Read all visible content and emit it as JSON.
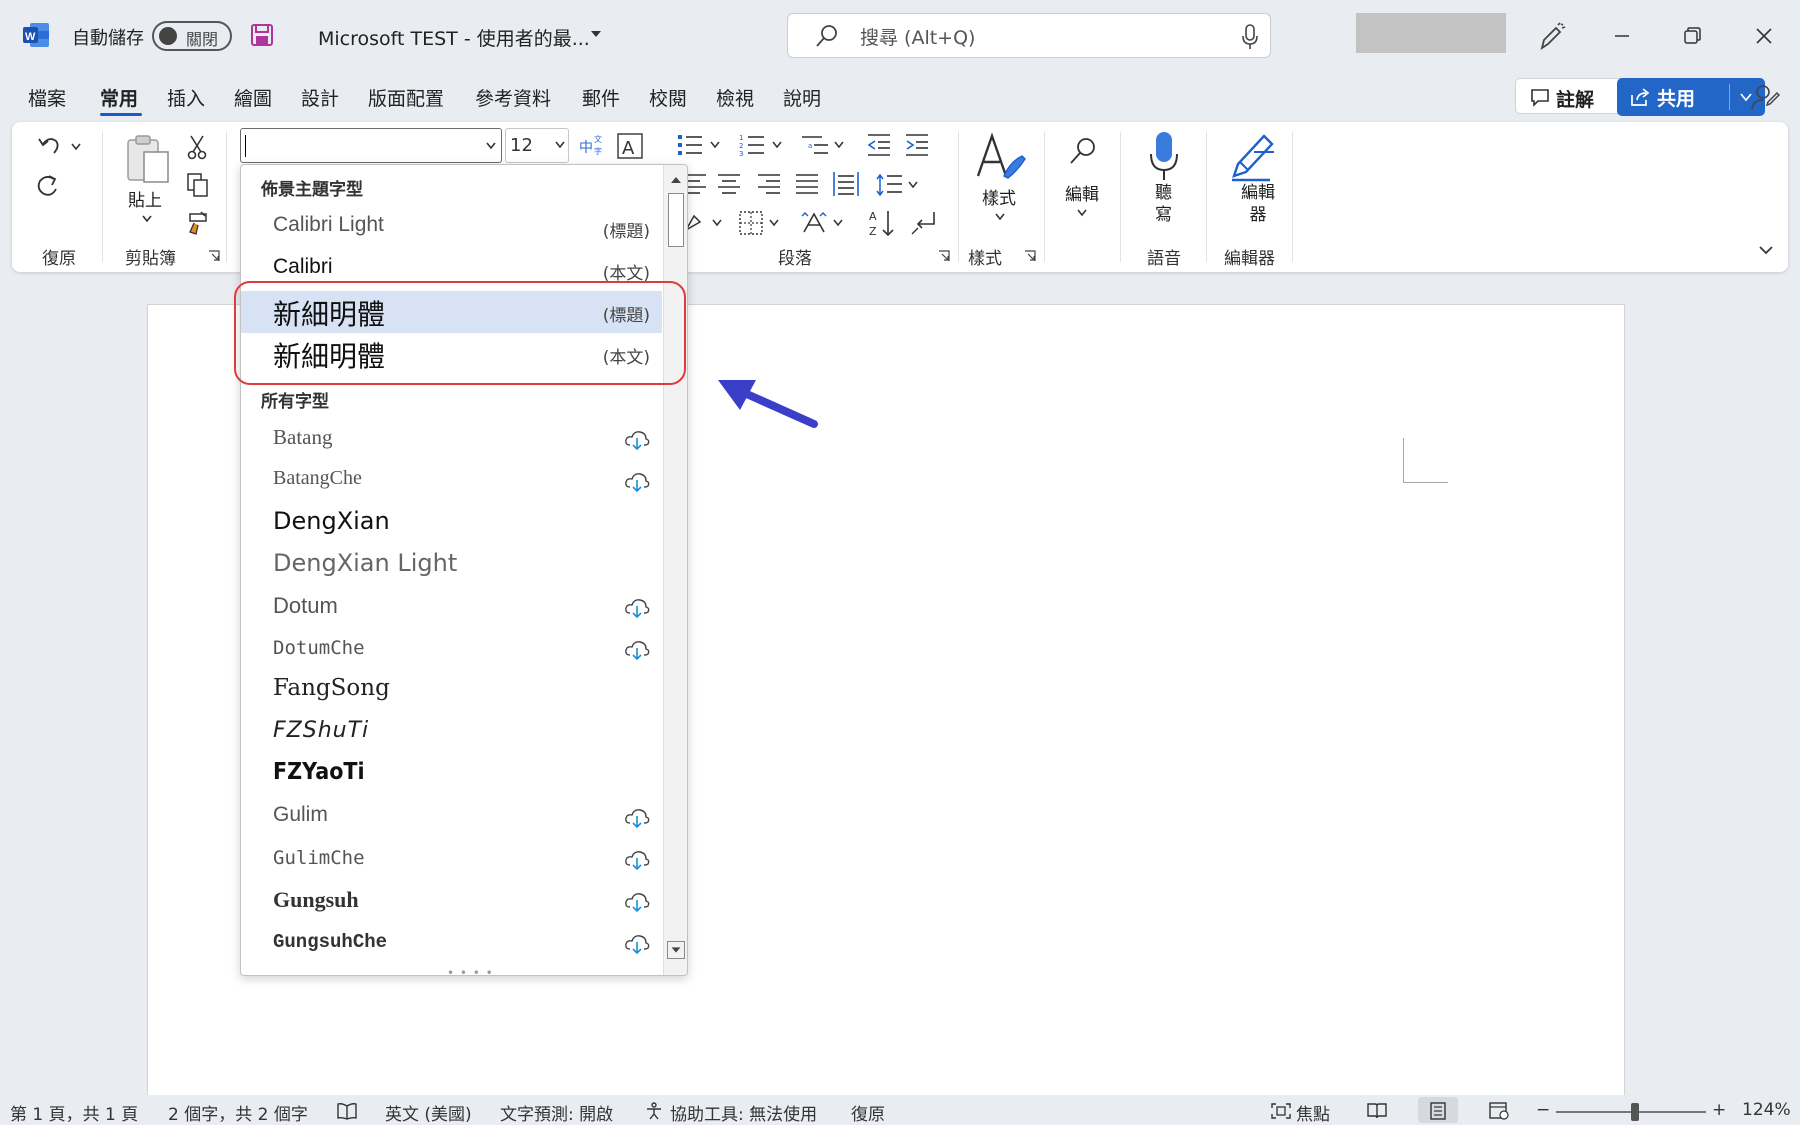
{
  "titlebar": {
    "autosave_label": "自動儲存",
    "autosave_state": "關閉",
    "doc_title": "Microsoft TEST  -  使用者的最...",
    "search_placeholder": "搜尋 (Alt+Q)"
  },
  "tabs": [
    {
      "label": "檔案"
    },
    {
      "label": "常用"
    },
    {
      "label": "插入"
    },
    {
      "label": "繪圖"
    },
    {
      "label": "設計"
    },
    {
      "label": "版面配置"
    },
    {
      "label": "參考資料"
    },
    {
      "label": "郵件"
    },
    {
      "label": "校閱"
    },
    {
      "label": "檢視"
    },
    {
      "label": "說明"
    }
  ],
  "actions": {
    "comment": "註解",
    "share": "共用"
  },
  "ribbon": {
    "undo_group": "復原",
    "paste": "貼上",
    "clipboard_group": "剪貼簿",
    "font_size": "12",
    "paragraph_group": "段落",
    "styles": "樣式",
    "styles_group": "樣式",
    "editing": "編輯",
    "dictate": "聽寫",
    "voice_group": "語音",
    "editor": "編輯器",
    "editor_group": "編輯器"
  },
  "font_dropdown": {
    "theme_section": "佈景主題字型",
    "theme_fonts": [
      {
        "name": "Calibri Light",
        "tag": "(標題)"
      },
      {
        "name": "Calibri",
        "tag": "(本文)"
      },
      {
        "name": "新細明體",
        "tag": "(標題)"
      },
      {
        "name": "新細明體",
        "tag": "(本文)"
      }
    ],
    "all_section": "所有字型",
    "all_fonts": [
      {
        "name": "Batang",
        "cloud": true
      },
      {
        "name": "BatangChe",
        "cloud": true
      },
      {
        "name": "DengXian",
        "cloud": false
      },
      {
        "name": "DengXian Light",
        "cloud": false
      },
      {
        "name": "Dotum",
        "cloud": true
      },
      {
        "name": "DotumChe",
        "cloud": true
      },
      {
        "name": "FangSong",
        "cloud": false
      },
      {
        "name": "FZShuTi",
        "cloud": false
      },
      {
        "name": "FZYaoTi",
        "cloud": false
      },
      {
        "name": "Gulim",
        "cloud": true
      },
      {
        "name": "GulimChe",
        "cloud": true
      },
      {
        "name": "Gungsuh",
        "cloud": true
      },
      {
        "name": "GungsuhChe",
        "cloud": true
      }
    ]
  },
  "statusbar": {
    "page": "第 1 頁，共 1 頁",
    "words": "2 個字，共 2 個字",
    "language": "英文 (美國)",
    "prediction": "文字預測: 開啟",
    "accessibility": "協助工具: 無法使用",
    "recover": "復原",
    "focus": "焦點",
    "zoom": "124%"
  },
  "colors": {
    "accent": "#2266c8",
    "highlight": "#e03a3a",
    "arrow": "#3a3fc9",
    "selected": "#d7e3f5"
  }
}
